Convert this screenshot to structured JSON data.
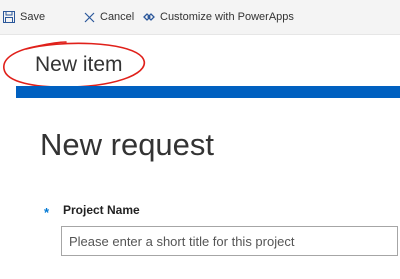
{
  "toolbar": {
    "save_label": "Save",
    "save_icon": "save-icon",
    "cancel_label": "Cancel",
    "cancel_icon": "close-icon",
    "customize_label": "Customize with PowerApps",
    "customize_icon": "powerapps-icon"
  },
  "panel": {
    "title": "New item"
  },
  "form": {
    "title": "New request",
    "fields": [
      {
        "label": "Project Name",
        "required": true,
        "required_marker": "*",
        "value": "",
        "placeholder": "Please enter a short title for this project"
      }
    ]
  },
  "colors": {
    "accent": "#0060c0",
    "required": "#0078d4",
    "annotation": "#e0201a",
    "toolbar_bg": "#f4f4f4"
  }
}
